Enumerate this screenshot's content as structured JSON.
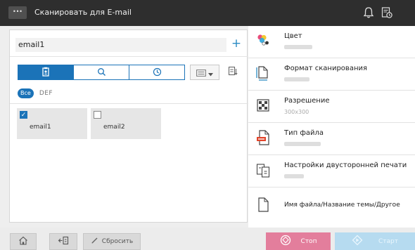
{
  "window": {
    "title": "Сканировать для E-mail",
    "menu_label": "···",
    "icons": [
      "bell-icon",
      "job-history-icon"
    ]
  },
  "address": {
    "value": "email1",
    "add_label": "+"
  },
  "search_tabs": [
    {
      "name": "address-book-icon",
      "active": true
    },
    {
      "name": "search-icon",
      "active": false
    },
    {
      "name": "history-icon",
      "active": false
    }
  ],
  "filter": {
    "all_label": "Все",
    "index_label": "DEF"
  },
  "destinations": [
    {
      "label": "email1",
      "checked": true
    },
    {
      "label": "email2",
      "checked": false
    }
  ],
  "settings": [
    {
      "name": "Цвет",
      "value": "",
      "icon": "color-icon"
    },
    {
      "name": "Формат сканирования",
      "value": "",
      "icon": "scan-size-icon"
    },
    {
      "name": "Разрешение",
      "value": "300x300",
      "icon": "resolution-icon"
    },
    {
      "name": "Тип файла",
      "value": "",
      "icon": "file-type-icon"
    },
    {
      "name": "Настройки двусторонней печати",
      "value": "",
      "icon": "duplex-icon"
    },
    {
      "name": "Имя файла/Название темы/Другое",
      "value": "",
      "icon": "file-name-icon"
    }
  ],
  "bottom": {
    "reset_label": "Сбросить",
    "stop_label": "Стоп",
    "start_label": "Старт"
  },
  "colors": {
    "accent": "#1b73b8",
    "stop": "#e37e9c",
    "start": "#b6dbf0",
    "titlebar": "#2e2e2e"
  }
}
